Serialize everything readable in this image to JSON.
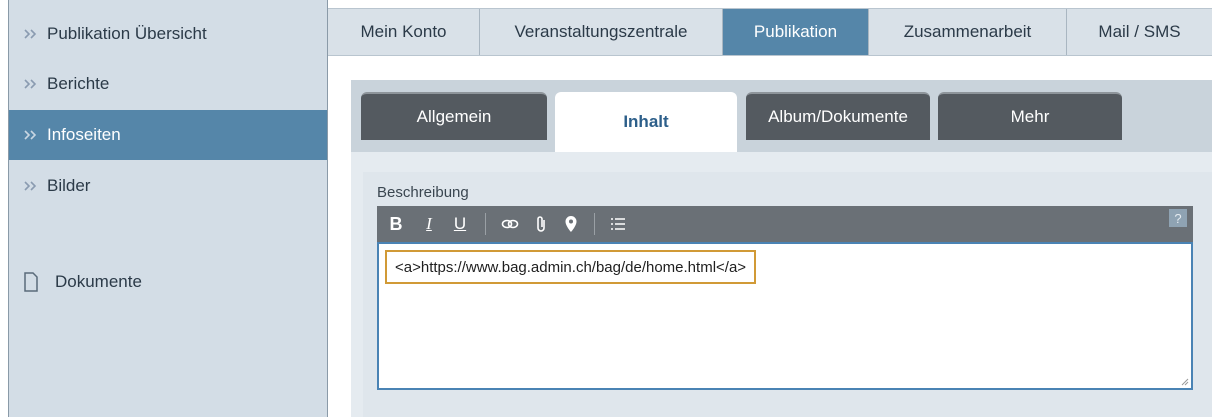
{
  "sidebar": {
    "items": [
      {
        "label": "Publikation Übersicht",
        "icon": "double-chevron-right-icon"
      },
      {
        "label": "Berichte",
        "icon": "double-chevron-right-icon"
      },
      {
        "label": "Infoseiten",
        "icon": "double-chevron-right-icon",
        "active": true
      },
      {
        "label": "Bilder",
        "icon": "double-chevron-right-icon"
      },
      {
        "label": "Dokumente",
        "icon": "document-icon"
      }
    ]
  },
  "topnav": {
    "tabs": [
      {
        "label": "Mein Konto"
      },
      {
        "label": "Veranstaltungszentrale"
      },
      {
        "label": "Publikation",
        "active": true
      },
      {
        "label": "Zusammenarbeit"
      },
      {
        "label": "Mail / SMS"
      }
    ]
  },
  "subtabs": [
    {
      "label": "Allgemein"
    },
    {
      "label": "Inhalt",
      "active": true
    },
    {
      "label": "Album/Dokumente"
    },
    {
      "label": "Mehr"
    }
  ],
  "editor": {
    "field_label": "Beschreibung",
    "toolbar": {
      "bold": "B",
      "italic": "I",
      "underline": "U",
      "help": "?",
      "icons": [
        "link-icon",
        "attachment-icon",
        "location-pin-icon",
        "list-icon"
      ]
    },
    "content": "<a>https://www.bag.admin.ch/bag/de/home.html</a>"
  },
  "colors": {
    "accent": "#5586a9",
    "highlight_border": "#d19a36",
    "editor_border": "#4a83b4"
  }
}
